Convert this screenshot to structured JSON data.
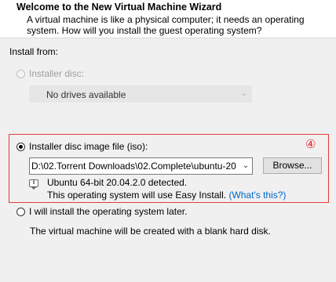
{
  "header": {
    "title": "Welcome to the New Virtual Machine Wizard",
    "description": "A virtual machine is like a physical computer; it needs an operating system. How will you install the guest operating system?"
  },
  "install_from": {
    "label": "Install from:",
    "installer_disc": {
      "label": "Installer disc:",
      "selected": false,
      "enabled": false,
      "dropdown_value": "No drives available"
    },
    "iso": {
      "label": "Installer disc image file (iso):",
      "selected": true,
      "path": "D:\\02.Torrent Downloads\\02.Complete\\ubuntu-20",
      "browse_label": "Browse...",
      "detected_line": "Ubuntu 64-bit 20.04.2.0 detected.",
      "easy_install_text": "This operating system will use Easy Install.",
      "whats_this_link": "(What's this?)"
    },
    "later": {
      "label": "I will install the operating system later.",
      "selected": false,
      "note": "The virtual machine will be created with a blank hard disk."
    }
  },
  "annotation": {
    "marker": "④",
    "color": "#e8262a"
  },
  "icons": {
    "dropdown": "chevron-down-icon",
    "info": "info-balloon-icon"
  }
}
